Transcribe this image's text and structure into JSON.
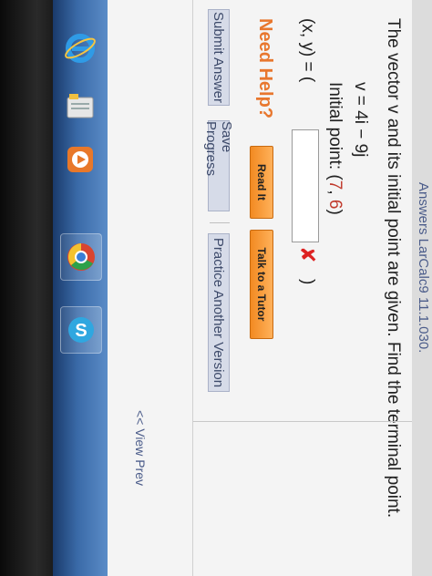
{
  "breadcrumb": {
    "text": "Answers  LarCalc9 11.1.030."
  },
  "question": {
    "intro": "The vector v and its initial point are given. Find the terminal point.",
    "vector": "v = 4i − 9j",
    "initial_label": "Initial point: (",
    "initial_x": "7",
    "initial_sep": ", ",
    "initial_y": "6",
    "initial_close": ")",
    "answer_prefix": "(x, y) = (",
    "answer_value": "",
    "answer_suffix": ")",
    "feedback_mark": "✘"
  },
  "help": {
    "title": "Need Help?",
    "read_it": "Read It",
    "talk_to_tutor": "Talk to a Tutor"
  },
  "actions": {
    "submit": "Submit Answer",
    "save": "Save Progress",
    "practice": "Practice Another Version"
  },
  "nav": {
    "view_previous": "<< View Prev"
  },
  "taskbar": {
    "icons": [
      "internet-explorer-icon",
      "file-manager-icon",
      "media-player-icon",
      "chrome-icon",
      "skype-icon"
    ]
  },
  "colors": {
    "accent_orange": "#e8772e",
    "error_red": "#d22222",
    "link_blue": "#4b5c8a"
  }
}
